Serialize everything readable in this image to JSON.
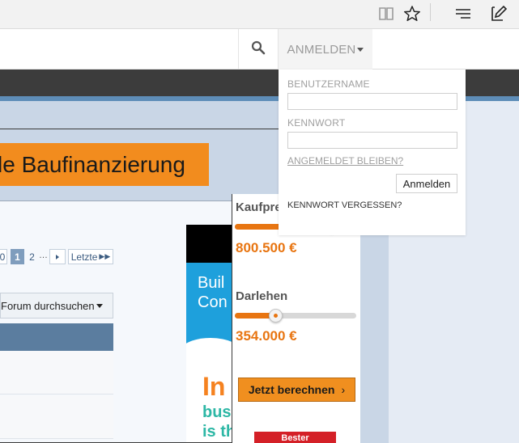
{
  "browser": {
    "reading_view_icon": "book-icon",
    "favorite_icon": "star-icon",
    "hub_icon": "hub-lines-icon",
    "notes_icon": "web-note-icon"
  },
  "header": {
    "search_icon": "search-icon",
    "login_label": "ANMELDEN"
  },
  "login": {
    "username_label": "BENUTZERNAME",
    "username_value": "",
    "password_label": "KENNWORT",
    "password_value": "",
    "stay_logged_in_label": "ANGEMELDET BLEIBEN?",
    "submit_label": "Anmelden",
    "forgot_label": "KENNWORT VERGESSEN?"
  },
  "forum": {
    "pagination": {
      "pages": [
        "0",
        "1",
        "2"
      ],
      "current": "1",
      "ellipsis": "…",
      "next_icon": "triangle-right-icon",
      "last_label": "Letzte"
    },
    "search_label": "Forum durchsuchen"
  },
  "ad_mortgage": {
    "banner_text": "le Baufinanzierung",
    "kaufpreis_label": "Kaufpreis",
    "kaufpreis_value": "800.500 €",
    "kaufpreis_level": 0.79,
    "darlehen_label": "Darlehen",
    "darlehen_value": "354.000 €",
    "darlehen_level": 0.33,
    "button_label": "Jetzt berechnen",
    "badge_text": "Bester"
  },
  "ad_build": {
    "line1": "Buil",
    "line2": "Con",
    "big": "In",
    "line3": "bus",
    "line4": "is th"
  },
  "colors": {
    "accent_orange": "#f28c1e",
    "forum_blue": "#5b7d9f",
    "nav_dark": "#3c3c3c"
  }
}
